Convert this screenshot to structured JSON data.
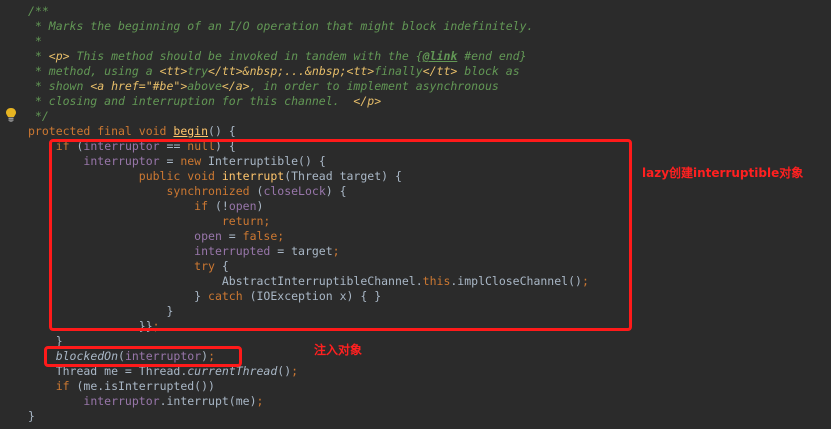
{
  "editor": {
    "lines": [
      [
        {
          "t": "/**",
          "c": "c-doc"
        }
      ],
      [
        {
          "t": " * Marks the beginning of an I/O operation that might block indefinitely.",
          "c": "c-doc"
        }
      ],
      [
        {
          "t": " *",
          "c": "c-doc"
        }
      ],
      [
        {
          "t": " * ",
          "c": "c-doc"
        },
        {
          "t": "<p>",
          "c": "c-html"
        },
        {
          "t": " This method should be invoked in tandem with the {",
          "c": "c-doc"
        },
        {
          "t": "@link",
          "c": "c-tag"
        },
        {
          "t": " #end end}",
          "c": "c-doc"
        }
      ],
      [
        {
          "t": " * method, using a ",
          "c": "c-doc"
        },
        {
          "t": "<tt>",
          "c": "c-html"
        },
        {
          "t": "try",
          "c": "c-doc"
        },
        {
          "t": "</tt>&nbsp;...&nbsp;<tt>",
          "c": "c-html"
        },
        {
          "t": "finally",
          "c": "c-doc"
        },
        {
          "t": "</tt>",
          "c": "c-html"
        },
        {
          "t": " block as",
          "c": "c-doc"
        }
      ],
      [
        {
          "t": " * shown ",
          "c": "c-doc"
        },
        {
          "t": "<a href=\"#be\">",
          "c": "c-html"
        },
        {
          "t": "above",
          "c": "c-doc"
        },
        {
          "t": "</a>",
          "c": "c-html"
        },
        {
          "t": ", in order to implement asynchronous",
          "c": "c-doc"
        }
      ],
      [
        {
          "t": " * closing and interruption for this channel.  ",
          "c": "c-doc"
        },
        {
          "t": "</p>",
          "c": "c-html"
        }
      ],
      [
        {
          "t": " */",
          "c": "c-doc"
        }
      ],
      [
        {
          "t": "protected final void ",
          "c": "kw"
        },
        {
          "t": "begin",
          "c": "fn-u"
        },
        {
          "t": "() {",
          "c": "txt"
        }
      ],
      [
        {
          "t": "    ",
          "c": "txt"
        },
        {
          "t": "if ",
          "c": "kw"
        },
        {
          "t": "(",
          "c": "txt"
        },
        {
          "t": "interruptor",
          "c": "fld"
        },
        {
          "t": " == ",
          "c": "txt"
        },
        {
          "t": "null",
          "c": "kw"
        },
        {
          "t": ") {",
          "c": "txt"
        }
      ],
      [
        {
          "t": "        ",
          "c": "txt"
        },
        {
          "t": "interruptor",
          "c": "fld"
        },
        {
          "t": " = ",
          "c": "txt"
        },
        {
          "t": "new ",
          "c": "kw"
        },
        {
          "t": "Interruptible() {",
          "c": "txt"
        }
      ],
      [
        {
          "t": "                ",
          "c": "txt"
        },
        {
          "t": "public void ",
          "c": "kw"
        },
        {
          "t": "interrupt",
          "c": "fn"
        },
        {
          "t": "(Thread target) {",
          "c": "txt"
        }
      ],
      [
        {
          "t": "                    ",
          "c": "txt"
        },
        {
          "t": "synchronized ",
          "c": "kw"
        },
        {
          "t": "(",
          "c": "txt"
        },
        {
          "t": "closeLock",
          "c": "fld"
        },
        {
          "t": ") {",
          "c": "txt"
        }
      ],
      [
        {
          "t": "                        ",
          "c": "txt"
        },
        {
          "t": "if ",
          "c": "kw"
        },
        {
          "t": "(!",
          "c": "txt"
        },
        {
          "t": "open",
          "c": "fld"
        },
        {
          "t": ")",
          "c": "txt"
        }
      ],
      [
        {
          "t": "                            ",
          "c": "txt"
        },
        {
          "t": "return",
          "c": "kw"
        },
        {
          "t": ";",
          "c": "kw"
        }
      ],
      [
        {
          "t": "                        ",
          "c": "txt"
        },
        {
          "t": "open",
          "c": "fld"
        },
        {
          "t": " = ",
          "c": "txt"
        },
        {
          "t": "false",
          "c": "kw"
        },
        {
          "t": ";",
          "c": "kw"
        }
      ],
      [
        {
          "t": "                        ",
          "c": "txt"
        },
        {
          "t": "interrupted",
          "c": "fld"
        },
        {
          "t": " = target",
          "c": "txt"
        },
        {
          "t": ";",
          "c": "kw"
        }
      ],
      [
        {
          "t": "                        ",
          "c": "txt"
        },
        {
          "t": "try ",
          "c": "kw"
        },
        {
          "t": "{",
          "c": "txt"
        }
      ],
      [
        {
          "t": "                            ",
          "c": "txt"
        },
        {
          "t": "AbstractInterruptibleChannel.",
          "c": "txt"
        },
        {
          "t": "this",
          "c": "kw"
        },
        {
          "t": ".implCloseChannel()",
          "c": "txt"
        },
        {
          "t": ";",
          "c": "kw"
        }
      ],
      [
        {
          "t": "                        ",
          "c": "txt"
        },
        {
          "t": "} ",
          "c": "txt"
        },
        {
          "t": "catch ",
          "c": "kw"
        },
        {
          "t": "(IOException x) { }",
          "c": "txt"
        }
      ],
      [
        {
          "t": "                    }",
          "c": "txt"
        }
      ],
      [
        {
          "t": "                }}",
          "c": "txt"
        },
        {
          "t": ";",
          "c": "kw"
        }
      ],
      [
        {
          "t": "    }",
          "c": "txt"
        }
      ],
      [
        {
          "t": "    ",
          "c": "txt"
        },
        {
          "t": "blockedOn",
          "c": "txt ital"
        },
        {
          "t": "(",
          "c": "txt"
        },
        {
          "t": "interruptor",
          "c": "fld"
        },
        {
          "t": ")",
          "c": "txt"
        },
        {
          "t": ";",
          "c": "kw"
        }
      ],
      [
        {
          "t": "    Thread me = Thread.",
          "c": "txt"
        },
        {
          "t": "currentThread",
          "c": "txt ital"
        },
        {
          "t": "()",
          "c": "txt"
        },
        {
          "t": ";",
          "c": "kw"
        }
      ],
      [
        {
          "t": "    ",
          "c": "txt"
        },
        {
          "t": "if ",
          "c": "kw"
        },
        {
          "t": "(me.isInterrupted())",
          "c": "txt"
        }
      ],
      [
        {
          "t": "        ",
          "c": "txt"
        },
        {
          "t": "interruptor",
          "c": "fld"
        },
        {
          "t": ".interrupt(me)",
          "c": "txt"
        },
        {
          "t": ";",
          "c": "kw"
        }
      ],
      [
        {
          "t": "}",
          "c": "txt"
        }
      ]
    ]
  },
  "annotations": {
    "lazy_create": "lazy创建interruptible对象",
    "inject": "注入对象"
  },
  "colors": {
    "background": "#2b2b2b",
    "highlight": "#ff1a1a",
    "comment": "#629755",
    "keyword": "#cc7832",
    "field": "#9876aa",
    "method": "#ffc66d"
  },
  "icons": {
    "gutter": "lightbulb-icon"
  }
}
